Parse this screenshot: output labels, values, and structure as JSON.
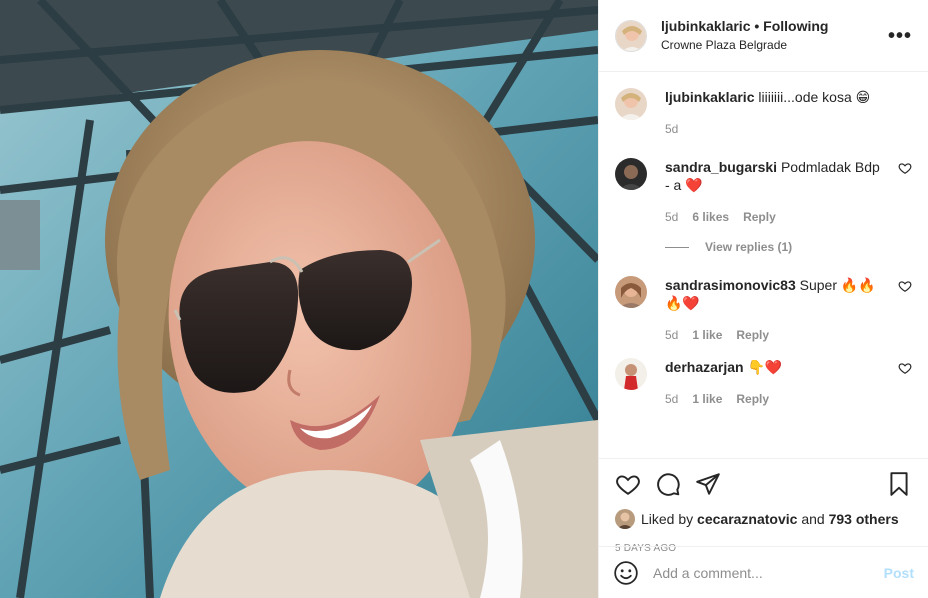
{
  "header": {
    "username": "ljubinkaklaric",
    "follow_status": "• Following",
    "location": "Crowne Plaza Belgrade",
    "more_label": "•••"
  },
  "caption": {
    "username": "ljubinkaklaric",
    "text": "liiiiiii...ode kosa 😁",
    "time": "5d"
  },
  "comments": [
    {
      "username": "sandra_bugarski",
      "text": "Podmladak Bdp - a ❤️",
      "time": "5d",
      "likes": "6 likes",
      "reply": "Reply"
    },
    {
      "username": "sandrasimonovic83",
      "text": "Super 🔥🔥🔥❤️",
      "time": "5d",
      "likes": "1 like",
      "reply": "Reply"
    },
    {
      "username": "derhazarjan",
      "text": "👇❤️",
      "time": "5d",
      "likes": "1 like",
      "reply": "Reply"
    }
  ],
  "view_replies": "View replies (1)",
  "likes": {
    "prefix": "Liked by",
    "user": "cecaraznatovic",
    "middle": "and",
    "others": "793 others"
  },
  "timestamp": "5 DAYS AGO",
  "add_comment": {
    "placeholder": "Add a comment...",
    "post_label": "Post"
  },
  "colors": {
    "text": "#262626",
    "muted": "#8e8e8e",
    "border": "#efefef",
    "post_disabled": "#b2dffc",
    "heart_red": "#ed4956"
  }
}
